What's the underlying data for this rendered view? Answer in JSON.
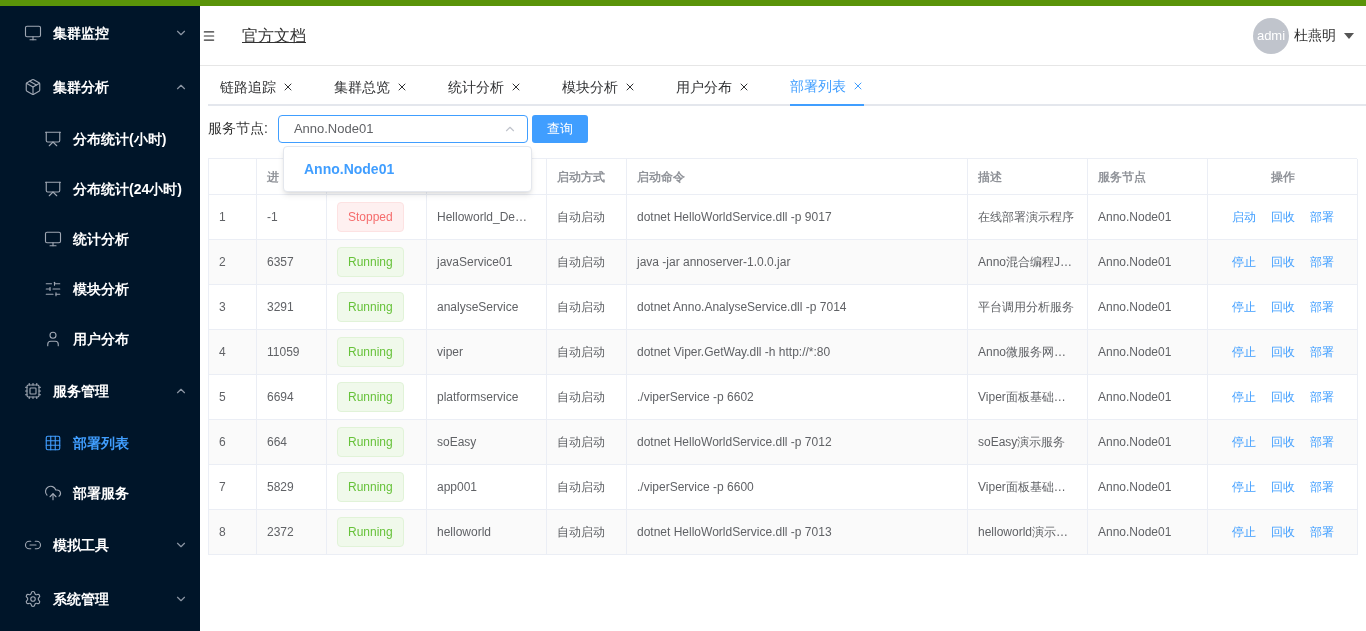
{
  "sidebar": {
    "groups": [
      {
        "label": "集群监控",
        "expanded": false
      },
      {
        "label": "集群分析",
        "expanded": true,
        "children": [
          {
            "label": "分布统计(小时)",
            "selected": false
          },
          {
            "label": "分布统计(24小时)",
            "selected": false
          },
          {
            "label": "统计分析",
            "selected": false
          },
          {
            "label": "模块分析",
            "selected": false
          },
          {
            "label": "用户分布",
            "selected": false
          }
        ]
      },
      {
        "label": "服务管理",
        "expanded": true,
        "children": [
          {
            "label": "部署列表",
            "selected": true
          },
          {
            "label": "部署服务",
            "selected": false
          }
        ]
      },
      {
        "label": "模拟工具",
        "expanded": false
      },
      {
        "label": "系统管理",
        "expanded": false
      }
    ]
  },
  "header": {
    "doc_link": "官方文档",
    "avatar": "admi",
    "user": "杜燕明"
  },
  "tabs": [
    {
      "label": "链路追踪",
      "selected": false
    },
    {
      "label": "集群总览",
      "selected": false
    },
    {
      "label": "统计分析",
      "selected": false
    },
    {
      "label": "模块分析",
      "selected": false
    },
    {
      "label": "用户分布",
      "selected": false
    },
    {
      "label": "部署列表",
      "selected": true
    }
  ],
  "filter": {
    "label": "服务节点:",
    "value": "Anno.Node01",
    "button": "查询",
    "options": [
      {
        "label": "Anno.Node01",
        "selected": true
      }
    ]
  },
  "table": {
    "columns": [
      "",
      "进",
      "",
      "",
      "启动方式",
      "启动命令",
      "描述",
      "服务节点",
      "操作"
    ],
    "rows": [
      {
        "no": "1",
        "pid": "-1",
        "status": "Stopped",
        "kind": "stopped",
        "name": "Helloworld_De…",
        "mode": "自动启动",
        "cmd": "dotnet HelloWorldService.dll -p 9017",
        "desc": "在线部署演示程序",
        "node": "Anno.Node01",
        "actions": [
          "启动",
          "回收",
          "部署"
        ]
      },
      {
        "no": "2",
        "pid": "6357",
        "status": "Running",
        "kind": "running",
        "name": "javaService01",
        "mode": "自动启动",
        "cmd": "java -jar annoserver-1.0.0.jar",
        "desc": "Anno混合编程J…",
        "node": "Anno.Node01",
        "actions": [
          "停止",
          "回收",
          "部署"
        ]
      },
      {
        "no": "3",
        "pid": "3291",
        "status": "Running",
        "kind": "running",
        "name": "analyseService",
        "mode": "自动启动",
        "cmd": "dotnet Anno.AnalyseService.dll -p 7014",
        "desc": "平台调用分析服务",
        "node": "Anno.Node01",
        "actions": [
          "停止",
          "回收",
          "部署"
        ]
      },
      {
        "no": "4",
        "pid": "11059",
        "status": "Running",
        "kind": "running",
        "name": "viper",
        "mode": "自动启动",
        "cmd": "dotnet Viper.GetWay.dll -h http://*:80",
        "desc": "Anno微服务网…",
        "node": "Anno.Node01",
        "actions": [
          "停止",
          "回收",
          "部署"
        ]
      },
      {
        "no": "5",
        "pid": "6694",
        "status": "Running",
        "kind": "running",
        "name": "platformservice",
        "mode": "自动启动",
        "cmd": "./viperService -p 6602",
        "desc": "Viper面板基础…",
        "node": "Anno.Node01",
        "actions": [
          "停止",
          "回收",
          "部署"
        ]
      },
      {
        "no": "6",
        "pid": "664",
        "status": "Running",
        "kind": "running",
        "name": "soEasy",
        "mode": "自动启动",
        "cmd": "dotnet HelloWorldService.dll -p 7012",
        "desc": "soEasy演示服务",
        "node": "Anno.Node01",
        "actions": [
          "停止",
          "回收",
          "部署"
        ]
      },
      {
        "no": "7",
        "pid": "5829",
        "status": "Running",
        "kind": "running",
        "name": "app001",
        "mode": "自动启动",
        "cmd": "./viperService -p 6600",
        "desc": "Viper面板基础…",
        "node": "Anno.Node01",
        "actions": [
          "停止",
          "回收",
          "部署"
        ]
      },
      {
        "no": "8",
        "pid": "2372",
        "status": "Running",
        "kind": "running",
        "name": "helloworld",
        "mode": "自动启动",
        "cmd": "dotnet HelloWorldService.dll -p 7013",
        "desc": "helloworld演示…",
        "node": "Anno.Node01",
        "actions": [
          "停止",
          "回收",
          "部署"
        ]
      }
    ]
  }
}
